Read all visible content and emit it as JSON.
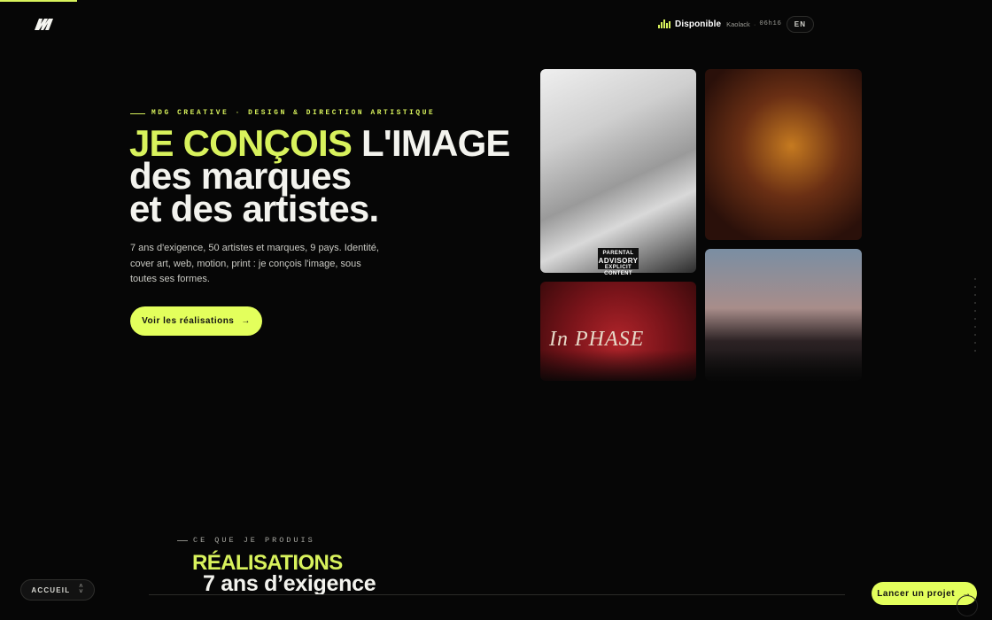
{
  "header": {
    "status": {
      "available_label": "Disponible",
      "city": "Kaolack",
      "separator": "·",
      "time": "06h16"
    },
    "language_button": "EN"
  },
  "hero": {
    "eyebrow": "MDG CREATIVE · DESIGN & DIRECTION ARTISTIQUE",
    "title_accent": "JE CONÇOIS",
    "title_rest_line1": "L'IMAGE",
    "title_line2": "des marques",
    "title_line3": "et des artistes.",
    "description": "7 ans d'exigence, 50 artistes et marques, 9 pays. Identité, cover art, web, motion, print : je conçois l'image, sous toutes ses formes.",
    "cta_label": "Voir les réalisations",
    "cta_arrow": "→"
  },
  "gallery": {
    "advisory_top": "PARENTAL",
    "advisory_main": "ADVISORY",
    "advisory_bottom": "EXPLICIT CONTENT",
    "phase_text": "In PHASE"
  },
  "section": {
    "eyebrow": "CE QUE JE PRODUIS",
    "title": "RÉALISATIONS",
    "subtitle": "7 ans d’exigence"
  },
  "footer": {
    "nav_label": "ACCUEIL",
    "launch_label": "Lancer un projet",
    "launch_arrow": "→"
  },
  "colors": {
    "accent": "#d8f25c",
    "background": "#060606"
  }
}
